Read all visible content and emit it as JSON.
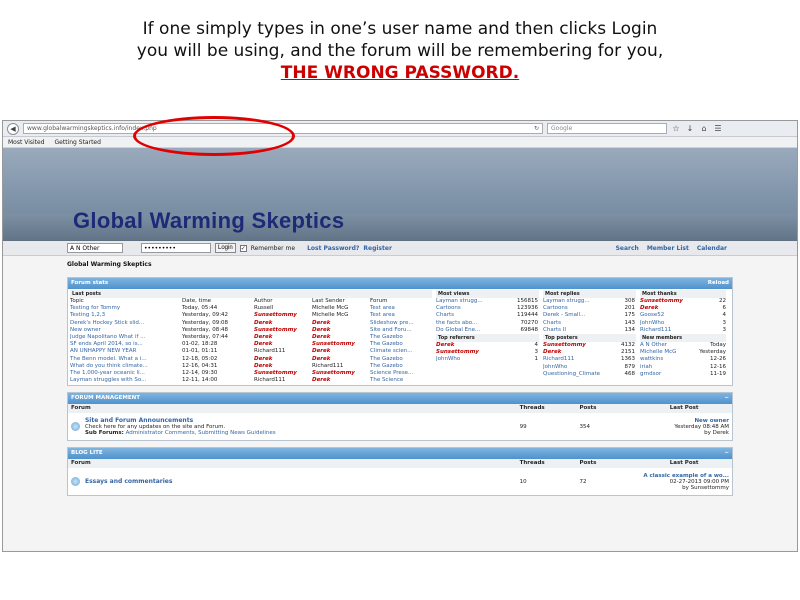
{
  "caption": {
    "line1": "If one simply types in one’s user name and then clicks Login",
    "line2": "you will be using, and the forum will be remembering for you,",
    "warning": "THE WRONG PASSWORD."
  },
  "browser": {
    "url": "www.globalwarmingskeptics.info/index.php",
    "search_placeholder": "Google",
    "bookmarks": [
      "Most Visited",
      "Getting Started"
    ]
  },
  "site": {
    "title": "Global Warming Skeptics"
  },
  "login": {
    "username": "A N Other",
    "password": "•••••••••",
    "login_label": "Login",
    "remember_label": "Remember me",
    "lost_password": "Lost Password?",
    "register": "Register",
    "search": "Search",
    "member_list": "Member List",
    "calendar": "Calendar"
  },
  "breadcrumb": "Global Warming Skeptics",
  "stats": {
    "title": "Forum stats",
    "reload": "Reload",
    "last_posts_title": "Last posts",
    "headers": [
      "Topic",
      "Date, time",
      "Author",
      "Last Sender",
      "Forum"
    ],
    "rows": [
      [
        "Testing for Tommy",
        "Today, 05:44",
        "Russell",
        "Michelle McG",
        "Test area"
      ],
      [
        "Testing 1,2,3",
        "Yesterday, 09:42",
        "Sunsettommy",
        "Michelle McG",
        "Test area"
      ],
      [
        "Derek's Hockey Stick slid...",
        "Yesterday, 09:08",
        "Derek",
        "Derek",
        "Slideshow pre..."
      ],
      [
        "New owner",
        "Yesterday, 08:48",
        "Sunsettommy",
        "Derek",
        "Site and Foru..."
      ],
      [
        "Judge Napolitano What if ...",
        "Yesterday, 07:44",
        "Derek",
        "Derek",
        "The Gazebo"
      ],
      [
        "SF ends April 2014, so is...",
        "01-02, 18:28",
        "Derek",
        "Sunsettommy",
        "The Gazebo"
      ],
      [
        "AN UNHAPPY NEW YEAR",
        "01-01, 01:11",
        "Richard111",
        "Derek",
        "Climate scien..."
      ],
      [
        "The Benn model. What a i...",
        "12-18, 05:02",
        "Derek",
        "Derek",
        "The Gazebo"
      ],
      [
        "What do you think climate...",
        "12-16, 04:31",
        "Derek",
        "Richard111",
        "The Gazebo"
      ],
      [
        "The 1,000-year oceanic li...",
        "12-14, 09:30",
        "Sunsettommy",
        "Sunsettommy",
        "Science Prese..."
      ],
      [
        "Layman struggles with So...",
        "12-11, 14:00",
        "Richard111",
        "Derek",
        "The Science"
      ]
    ],
    "most_views_title": "Most views",
    "most_views": [
      [
        "Layman strugg...",
        "156815"
      ],
      [
        "Cartoons",
        "123936"
      ],
      [
        "Charts",
        "119444"
      ],
      [
        "the facts abo...",
        "70270"
      ],
      [
        "Do Global Ene...",
        "69848"
      ]
    ],
    "most_replies_title": "Most replies",
    "most_replies": [
      [
        "Layman strugg...",
        "308"
      ],
      [
        "Cartoons",
        "201"
      ],
      [
        "Derek - Small...",
        "175"
      ],
      [
        "Charts",
        "143"
      ],
      [
        "Charts II",
        "134"
      ]
    ],
    "most_thanks_title": "Most thanks",
    "most_thanks": [
      [
        "Sunsettommy",
        "22"
      ],
      [
        "Derek",
        "6"
      ],
      [
        "Goose52",
        "4"
      ],
      [
        "JohnWho",
        "3"
      ],
      [
        "Richard111",
        "3"
      ]
    ],
    "top_referrers_title": "Top referrers",
    "top_referrers": [
      [
        "Derek",
        "4"
      ],
      [
        "Sunsettommy",
        "3"
      ],
      [
        "JohnWho",
        "1"
      ]
    ],
    "top_posters_title": "Top posters",
    "top_posters": [
      [
        "Sunsettommy",
        "4132"
      ],
      [
        "Derek",
        "2151"
      ],
      [
        "Richard111",
        "1363"
      ],
      [
        "JohnWho",
        "879"
      ],
      [
        "Questioning_Climate",
        "468"
      ]
    ],
    "new_members_title": "New members",
    "new_members": [
      [
        "A N Other",
        "Today"
      ],
      [
        "Michelle McG",
        "Yesterday"
      ],
      [
        "wattkins",
        "12-26"
      ],
      [
        "iriah",
        "12-16"
      ],
      [
        "grndsor",
        "11-19"
      ]
    ]
  },
  "forum_management": {
    "title": "FORUM MANAGEMENT",
    "headers": {
      "forum": "Forum",
      "threads": "Threads",
      "posts": "Posts",
      "last_post": "Last Post"
    },
    "name": "Site and Forum Announcements",
    "desc": "Check here for any updates on the site and Forum.",
    "subforums_label": "Sub Forums:",
    "subforum1": "Administrator Comments,",
    "subforum2": "Submitting News Guidelines",
    "threads": "99",
    "posts": "354",
    "last_title": "New owner",
    "last_date": "Yesterday 08:48 AM",
    "last_by": "by Derek"
  },
  "blog_lite": {
    "title": "BLOG LITE",
    "headers": {
      "forum": "Forum",
      "threads": "Threads",
      "posts": "Posts",
      "last_post": "Last Post"
    },
    "name": "Essays and commentaries",
    "threads": "10",
    "posts": "72",
    "last_title": "A classic example of a wo...",
    "last_date": "02-27-2013 09:00 PM",
    "last_by": "by Sunsettommy"
  }
}
